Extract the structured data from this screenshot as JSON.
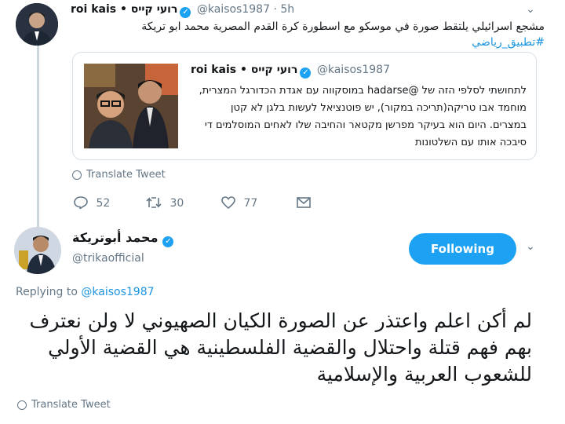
{
  "tweet1": {
    "name": "roi kais • רועי קייס",
    "handle": "@kaisos1987",
    "separator": "·",
    "time": "5h",
    "text": "مشجع اسرائيلي يلتقط صورة في موسكو مع اسطورة كرة القدم المصرية محمد ابو تريكة",
    "hashtag": "#تطبيق_رياضي",
    "quoted": {
      "name": "roi kais • רועי קייס",
      "handle": "@kaisos1987",
      "text": "לתחושתי לסלפי הזה של @hadarse במוסקווה עם אגדת הכדורגל המצרית, מוחמד אבו טריקה(תריכה במקור), יש פוטנציאל לעשות בלגן לא קטן במצרים. היום הוא בעיקר מפרשן מקטאר והחיבה שלו לאחים המוסלמים די סיבכה אותו עם השלטונות"
    },
    "translate_label": "Translate Tweet",
    "replies": "52",
    "retweets": "30",
    "likes": "77"
  },
  "tweet2": {
    "name": "محمد أبوتريكة",
    "handle": "@trikaofficial",
    "follow_label": "Following",
    "replying_prefix": "Replying to",
    "replying_to": "@kaisos1987",
    "text": "لم أكن اعلم واعتذر عن الصورة الكيان الصهيوني لا ولن نعترف بهم فهم قتلة واحتلال والقضية الفلسطينية هي القضية الأولي للشعوب العربية والإسلامية",
    "translate_label": "Translate Tweet"
  },
  "colors": {
    "accent": "#1da1f2",
    "link": "#1b95e0",
    "muted": "#657786"
  }
}
